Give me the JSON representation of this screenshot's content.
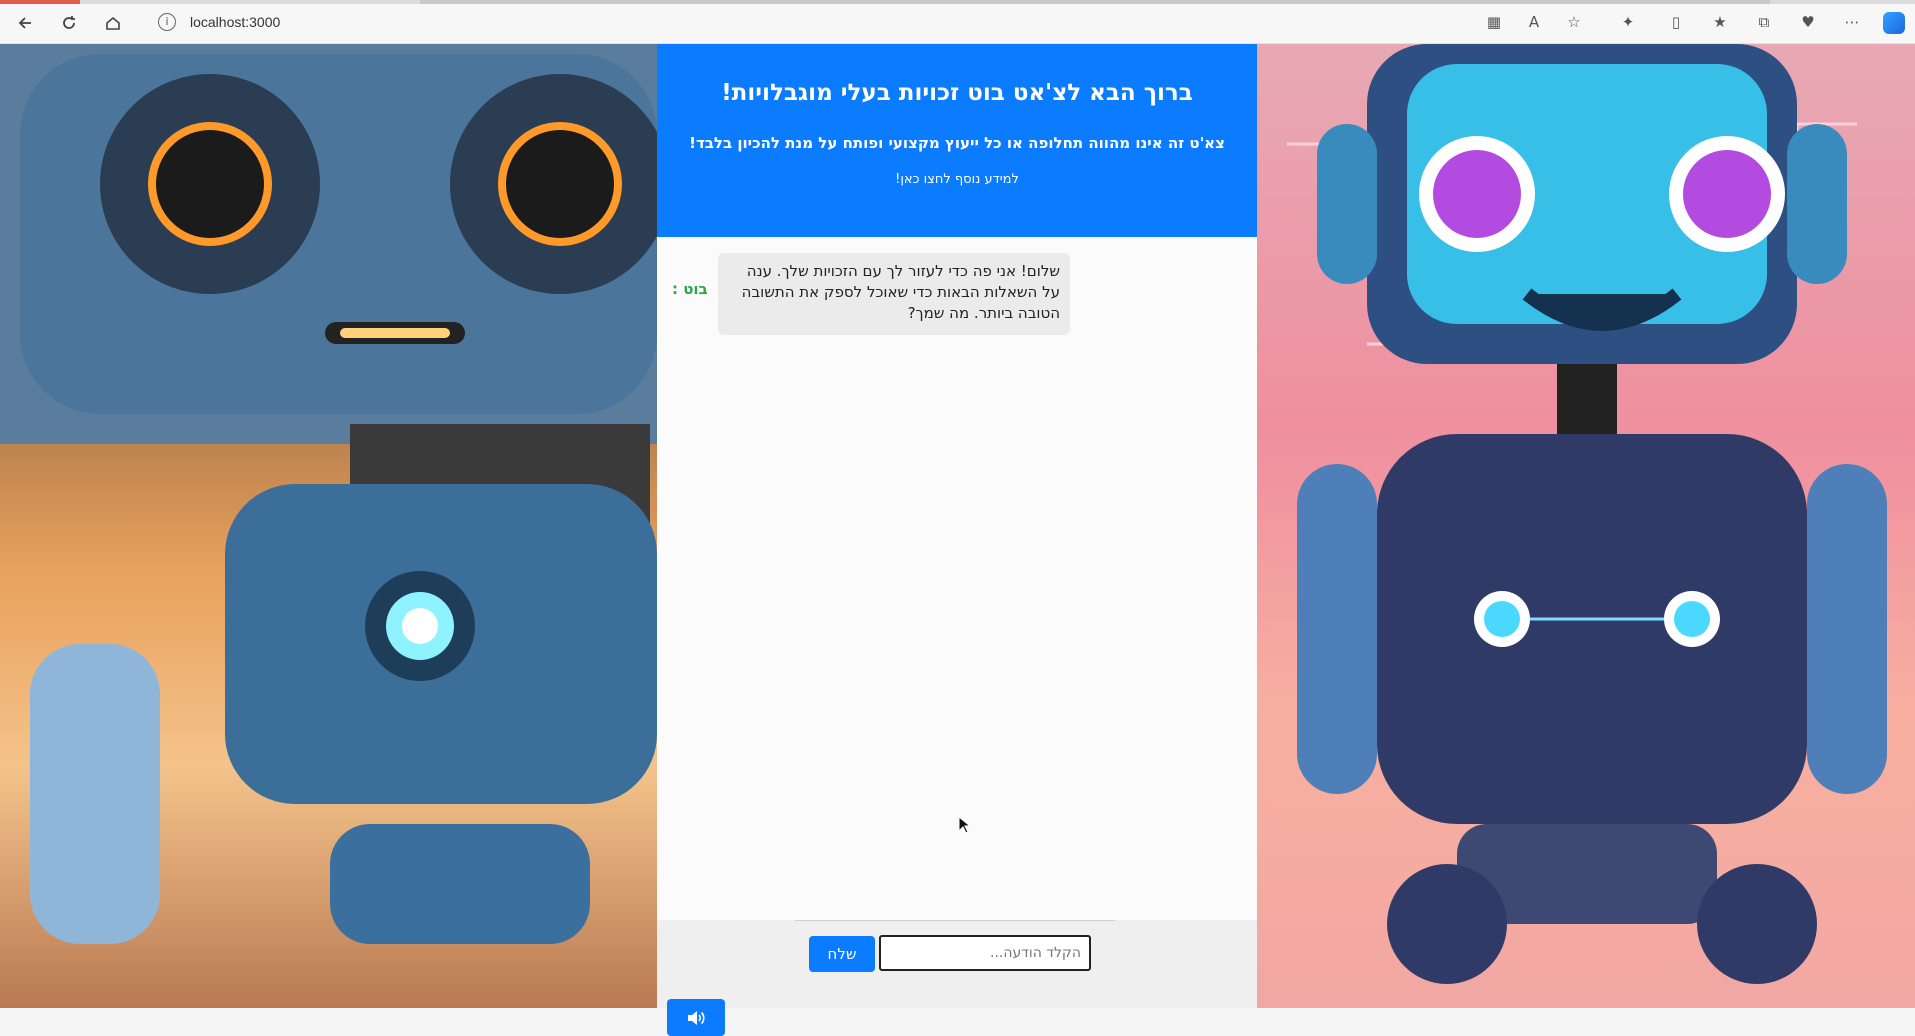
{
  "browser": {
    "url": "localhost:3000"
  },
  "header": {
    "title": "ברוך הבא לצ'אט בוט זכויות בעלי מוגבלויות!",
    "subtitle": "צא'ט זה אינו מהווה תחלופה או כל ייעוץ מקצועי ופותח על מנת להכיון בלבד!",
    "link": "למידע נוסף לחצו כאן!"
  },
  "chat": {
    "messages": [
      {
        "sender": "בוט :",
        "text": "שלום! אני פה כדי לעזור לך עם הזכויות שלך. ענה על השאלות הבאות כדי שאוכל לספק את התשובה הטובה ביותר. מה שמך?"
      }
    ]
  },
  "input": {
    "placeholder": "הקלד הודעה..."
  },
  "buttons": {
    "send": "שלח"
  },
  "colors": {
    "primary": "#0b7bff",
    "sender": "#2ea44f"
  },
  "icons": {
    "speaker": "speaker-icon"
  }
}
